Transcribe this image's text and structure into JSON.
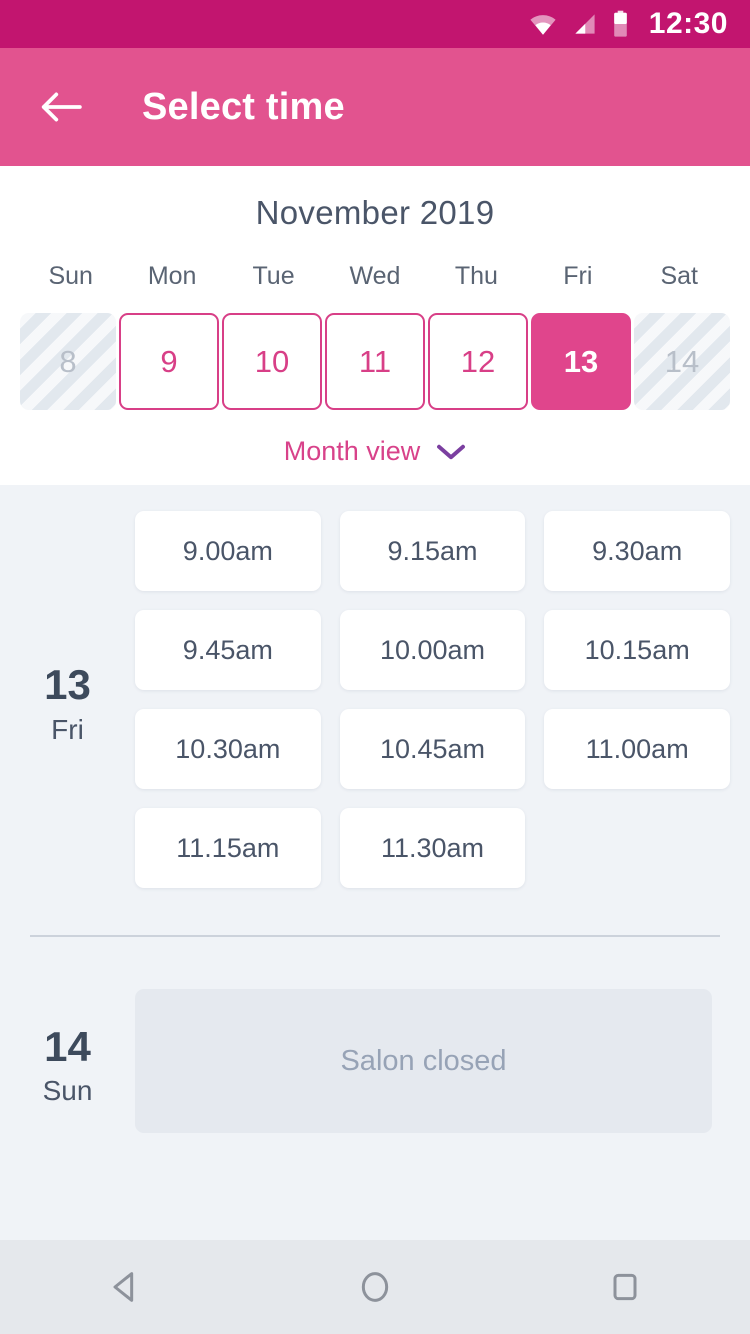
{
  "statusbar": {
    "time": "12:30",
    "icons": [
      "wifi-icon",
      "signal-icon",
      "battery-icon"
    ]
  },
  "appbar": {
    "title": "Select time",
    "back_icon": "arrow-left-icon"
  },
  "calendar": {
    "month_title": "November 2019",
    "weekdays": [
      "Sun",
      "Mon",
      "Tue",
      "Wed",
      "Thu",
      "Fri",
      "Sat"
    ],
    "dates": [
      {
        "day": "8",
        "state": "disabled"
      },
      {
        "day": "9",
        "state": "available"
      },
      {
        "day": "10",
        "state": "available"
      },
      {
        "day": "11",
        "state": "available"
      },
      {
        "day": "12",
        "state": "available"
      },
      {
        "day": "13",
        "state": "selected"
      },
      {
        "day": "14",
        "state": "disabled"
      }
    ],
    "month_view_label": "Month view",
    "month_view_icon": "chevron-down-icon"
  },
  "days": [
    {
      "day_number": "13",
      "day_of_week": "Fri",
      "slots": [
        "9.00am",
        "9.15am",
        "9.30am",
        "9.45am",
        "10.00am",
        "10.15am",
        "10.30am",
        "10.45am",
        "11.00am",
        "11.15am",
        "11.30am"
      ]
    },
    {
      "day_number": "14",
      "day_of_week": "Sun",
      "closed_message": "Salon closed"
    }
  ],
  "navbar": {
    "back_icon": "triangle-back-icon",
    "home_icon": "circle-home-icon",
    "recents_icon": "square-recents-icon"
  },
  "colors": {
    "status_bar": "#c2156f",
    "app_bar": "#e2538f",
    "accent_pink": "#d8428a",
    "selected_pink": "#e0458c",
    "body_bg": "#f0f3f7",
    "text_slate": "#4a5568",
    "chevron_purple": "#7b3fa0"
  }
}
